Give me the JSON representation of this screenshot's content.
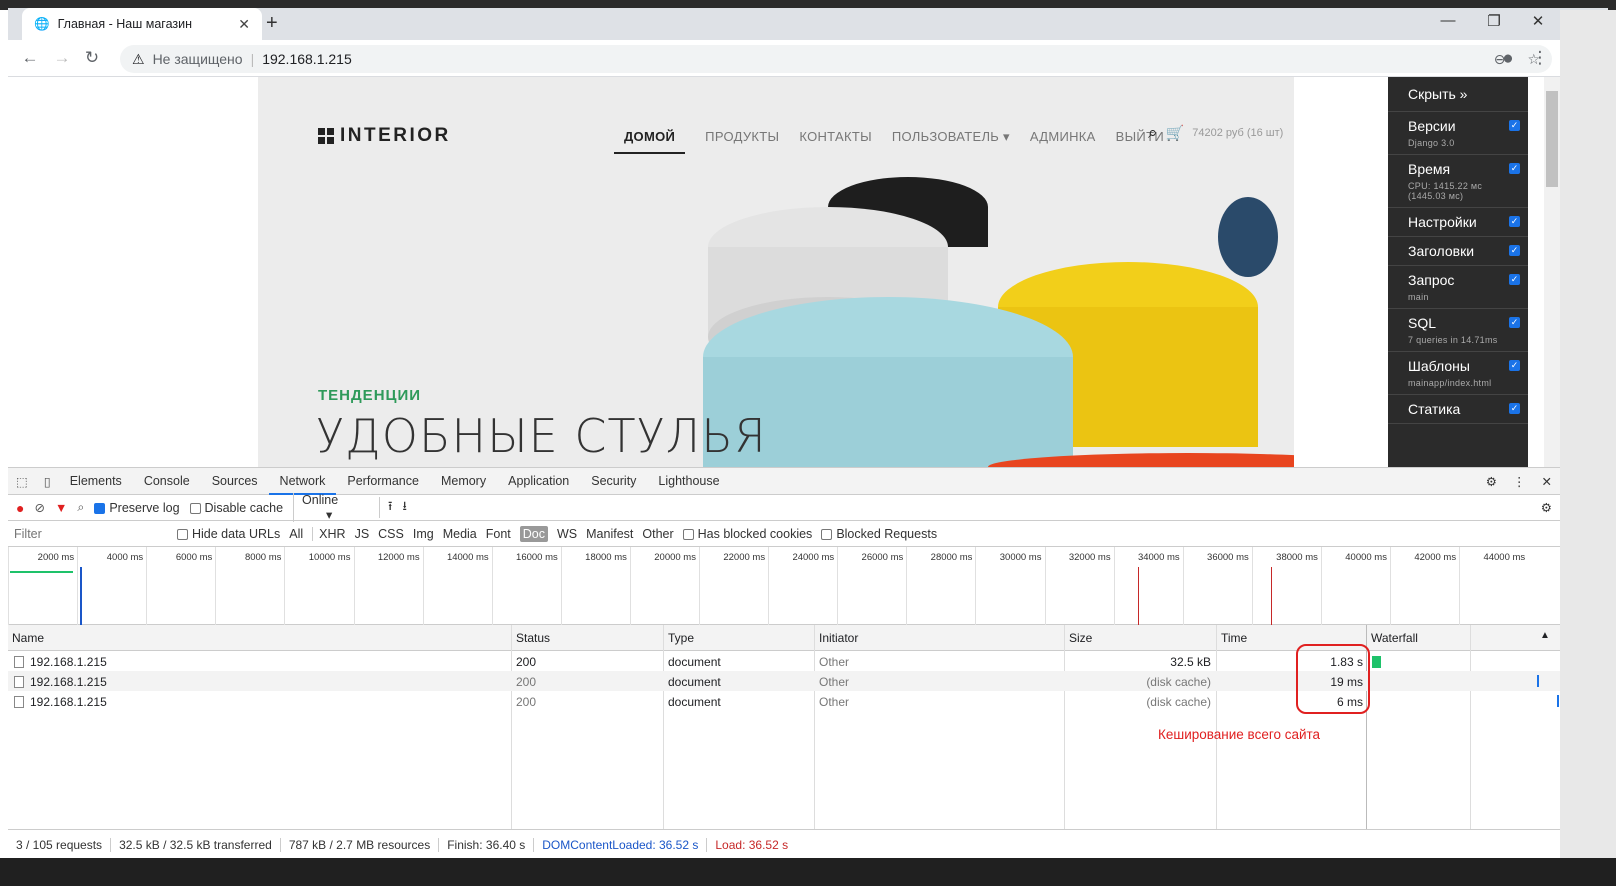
{
  "tab": {
    "title": "Главная - Наш магазин"
  },
  "address": {
    "security": "Не защищено",
    "url": "192.168.1.215"
  },
  "site": {
    "logo": "INTERIOR",
    "nav": [
      "ДОМОЙ",
      "ПРОДУКТЫ",
      "КОНТАКТЫ",
      "ПОЛЬЗОВАТЕЛЬ ▾",
      "АДМИНКА",
      "ВЫЙТИ"
    ],
    "cart": "74202 руб (16 шт)",
    "trend": "ТЕНДЕНЦИИ",
    "hero": "УДОБНЫЕ СТУЛЬЯ"
  },
  "djdt": {
    "hide": "Скрыть »",
    "panels": [
      {
        "title": "Версии",
        "sub": "Django 3.0"
      },
      {
        "title": "Время",
        "sub": "CPU: 1415.22 мс (1445.03 мс)"
      },
      {
        "title": "Настройки",
        "sub": ""
      },
      {
        "title": "Заголовки",
        "sub": ""
      },
      {
        "title": "Запрос",
        "sub": "main"
      },
      {
        "title": "SQL",
        "sub": "7 queries in 14.71ms"
      },
      {
        "title": "Шаблоны",
        "sub": "mainapp/index.html"
      },
      {
        "title": "Статика",
        "sub": ""
      }
    ]
  },
  "devtools": {
    "tabs": [
      "Elements",
      "Console",
      "Sources",
      "Network",
      "Performance",
      "Memory",
      "Application",
      "Security",
      "Lighthouse"
    ],
    "active_tab": "Network",
    "toolbar": {
      "preserve_log": "Preserve log",
      "disable_cache": "Disable cache",
      "throttle": "Online"
    },
    "filter": {
      "placeholder": "Filter",
      "hide_data": "Hide data URLs",
      "types": [
        "All",
        "XHR",
        "JS",
        "CSS",
        "Img",
        "Media",
        "Font",
        "Doc",
        "WS",
        "Manifest",
        "Other"
      ],
      "blocked_cookies": "Has blocked cookies",
      "blocked_requests": "Blocked Requests"
    },
    "ticks": [
      "2000 ms",
      "4000 ms",
      "6000 ms",
      "8000 ms",
      "10000 ms",
      "12000 ms",
      "14000 ms",
      "16000 ms",
      "18000 ms",
      "20000 ms",
      "22000 ms",
      "24000 ms",
      "26000 ms",
      "28000 ms",
      "30000 ms",
      "32000 ms",
      "34000 ms",
      "36000 ms",
      "38000 ms",
      "40000 ms",
      "42000 ms",
      "44000 ms"
    ],
    "columns": [
      "Name",
      "Status",
      "Type",
      "Initiator",
      "Size",
      "Time",
      "Waterfall"
    ],
    "rows": [
      {
        "name": "192.168.1.215",
        "status": "200",
        "type": "document",
        "initiator": "Other",
        "size": "32.5 kB",
        "time": "1.83 s"
      },
      {
        "name": "192.168.1.215",
        "status": "200",
        "type": "document",
        "initiator": "Other",
        "size": "(disk cache)",
        "time": "19 ms"
      },
      {
        "name": "192.168.1.215",
        "status": "200",
        "type": "document",
        "initiator": "Other",
        "size": "(disk cache)",
        "time": "6 ms"
      }
    ],
    "annotation": "Кеширование всего сайта",
    "status": {
      "requests": "3 / 105 requests",
      "transferred": "32.5 kB / 32.5 kB transferred",
      "resources": "787 kB / 2.7 MB resources",
      "finish": "Finish: 36.40 s",
      "dcl": "DOMContentLoaded: 36.52 s",
      "load": "Load: 36.52 s"
    }
  }
}
